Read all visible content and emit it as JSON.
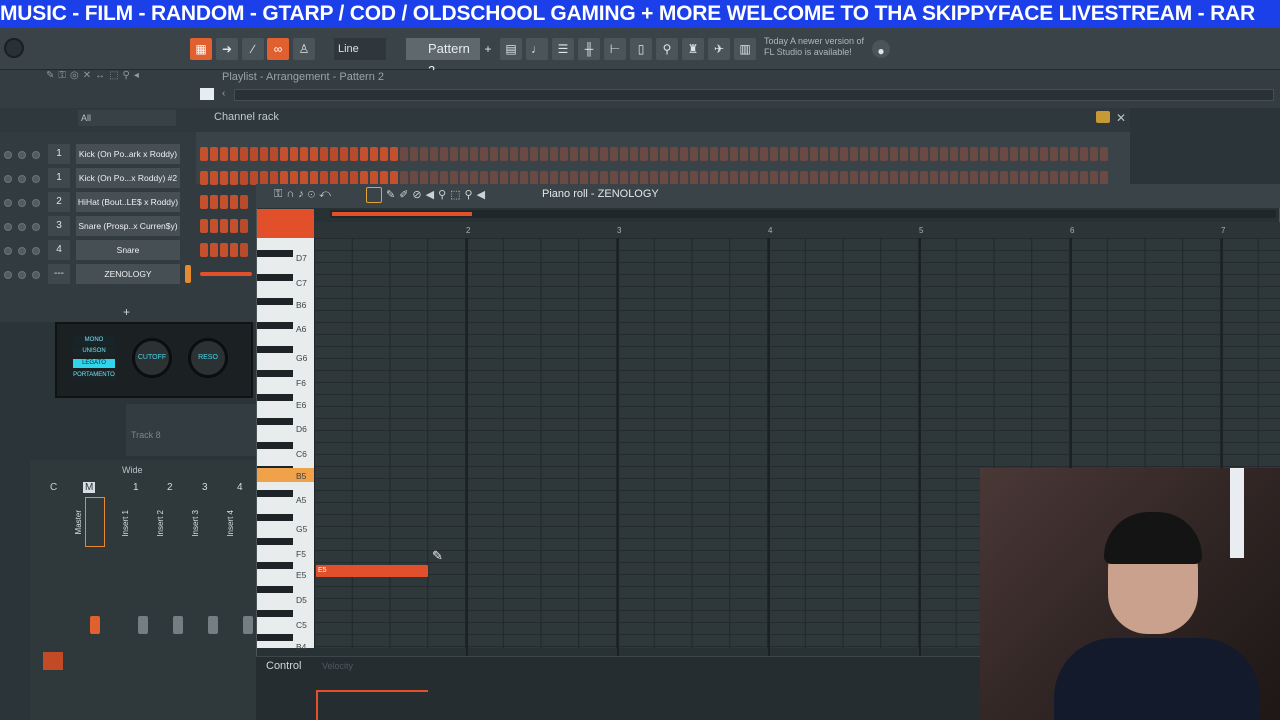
{
  "ticker": "MUSIC - FILM - RANDOM - GTARP / COD / OLDSCHOOL GAMING + MORE  WELCOME TO THA SKIPPYFACE LIVESTREAM  - RAR",
  "toolbar": {
    "line_label": "Line",
    "pattern_label": "Pattern 2",
    "news_line1": "Today  A newer version of",
    "news_line2": "FL Studio is available!"
  },
  "playlist": {
    "title": "Playlist - Arrangement - Pattern 2"
  },
  "channel_rack": {
    "title": "Channel rack",
    "filter": "All",
    "channels": [
      {
        "num": "1",
        "name": "Kick (On Po..ark x Roddy)",
        "color": "#c4502e"
      },
      {
        "num": "1",
        "name": "Kick (On Po...x Roddy) #2",
        "color": "#c4502e"
      },
      {
        "num": "2",
        "name": "HiHat (Bout..LE$ x Roddy)",
        "color": "#c4502e"
      },
      {
        "num": "3",
        "name": "Snare (Prosp..x Curren$y)",
        "color": "#c4502e"
      },
      {
        "num": "4",
        "name": "Snare",
        "color": "#c4502e"
      },
      {
        "num": "---",
        "name": "ZENOLOGY",
        "color": "#e2502b"
      }
    ],
    "add_label": "+"
  },
  "synth": {
    "modes": [
      "MONO",
      "UNISON",
      "LEGATO",
      "PORTAMENTO"
    ],
    "active_mode": "LEGATO",
    "knobs": [
      "CUTOFF",
      "RESO"
    ]
  },
  "track8": "Track 8",
  "mixer": {
    "preset": "Wide",
    "headers": [
      "C",
      "M",
      "1",
      "2",
      "3",
      "4"
    ],
    "tracks": [
      "Master",
      "Insert 1",
      "Insert 2",
      "Insert 3",
      "Insert 4"
    ]
  },
  "piano_roll": {
    "title": "Piano roll - ZENOLOGY",
    "bars": [
      "2",
      "3",
      "4",
      "5",
      "6",
      "7"
    ],
    "keys": [
      "D7",
      "C7",
      "B6",
      "A6",
      "G6",
      "F6",
      "E6",
      "D6",
      "C6",
      "B5",
      "A5",
      "G5",
      "F5",
      "E5",
      "D5",
      "C5",
      "B4"
    ],
    "highlighted_key": "B5",
    "note_label": "E5",
    "control_label": "Control",
    "control_value": "Velocity"
  },
  "colors": {
    "accent": "#e2502b",
    "ticker_bg": "#1b3fe8",
    "cyan": "#2fd5ea"
  }
}
